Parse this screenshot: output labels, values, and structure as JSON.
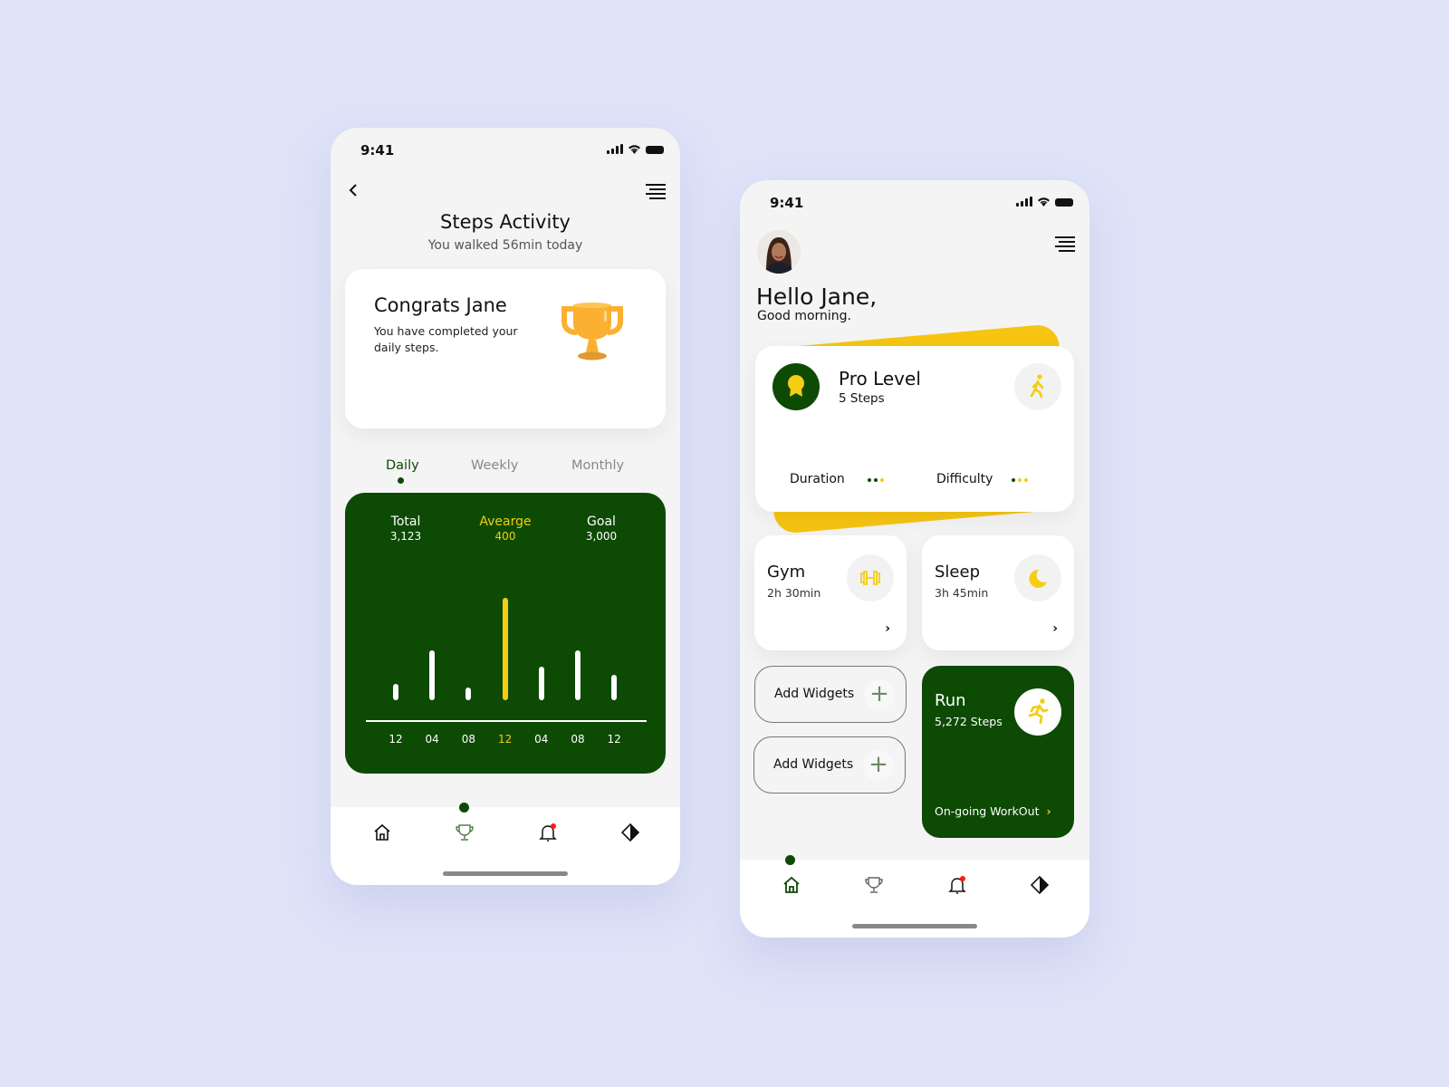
{
  "colors": {
    "primary_green": "#0d4a04",
    "accent_yellow": "#f5cd12",
    "background": "#dfe3f8",
    "notification_red": "#ff1a1a"
  },
  "steps_screen": {
    "status_bar": {
      "time": "9:41"
    },
    "header": {
      "back_icon": "chevron-left-icon",
      "menu_icon": "menu-icon",
      "title": "Steps Activity",
      "subtitle": "You walked 56min today"
    },
    "congrats_card": {
      "title": "Congrats Jane",
      "message": "You have completed your daily steps.",
      "icon": "trophy-icon"
    },
    "tabs": [
      {
        "label": "Daily",
        "active": true
      },
      {
        "label": "Weekly",
        "active": false
      },
      {
        "label": "Monthly",
        "active": false
      }
    ],
    "stats": [
      {
        "label": "Total",
        "value": "3,123",
        "highlight": false
      },
      {
        "label": "Avearge",
        "value": "400",
        "highlight": true
      },
      {
        "label": "Goal",
        "value": "3,000",
        "highlight": false
      }
    ],
    "nav": {
      "items": [
        "home-icon",
        "trophy-icon",
        "bell-icon",
        "contrast-icon"
      ],
      "active": 1,
      "bell_has_notification": true
    }
  },
  "chart_data": {
    "type": "bar",
    "title": "",
    "xlabel": "",
    "ylabel": "",
    "categories": [
      "12",
      "04",
      "08",
      "12",
      "04",
      "08",
      "12"
    ],
    "values": [
      20,
      61,
      15,
      125,
      41,
      61,
      31
    ],
    "highlight_index": 3,
    "ylim": [
      0,
      130
    ],
    "grid": false
  },
  "home_screen": {
    "status_bar": {
      "time": "9:41"
    },
    "header": {
      "menu_icon": "menu-icon",
      "greeting": "Hello Jane,",
      "subgreeting": "Good morning."
    },
    "pro_card": {
      "title": "Pro Level",
      "steps": "5 Steps",
      "badge_icon": "award-icon",
      "action_icon": "walking-icon",
      "duration": {
        "label": "Duration",
        "dots": [
          "green",
          "green",
          "yellow"
        ]
      },
      "difficulty": {
        "label": "Difficulty",
        "dots": [
          "green",
          "yellow",
          "yellow"
        ]
      }
    },
    "gym": {
      "title": "Gym",
      "value": "2h 30min",
      "icon": "dumbbell-icon"
    },
    "sleep": {
      "title": "Sleep",
      "value": "3h 45min",
      "icon": "moon-icon"
    },
    "add_widgets": [
      {
        "label": "Add Widgets"
      },
      {
        "label": "Add Widgets"
      }
    ],
    "run": {
      "title": "Run",
      "value": "5,272 Steps",
      "icon": "running-icon",
      "ongoing": "On-going WorkOut"
    },
    "nav": {
      "items": [
        "home-icon",
        "trophy-icon",
        "bell-icon",
        "contrast-icon"
      ],
      "active": 0,
      "bell_has_notification": true
    }
  }
}
